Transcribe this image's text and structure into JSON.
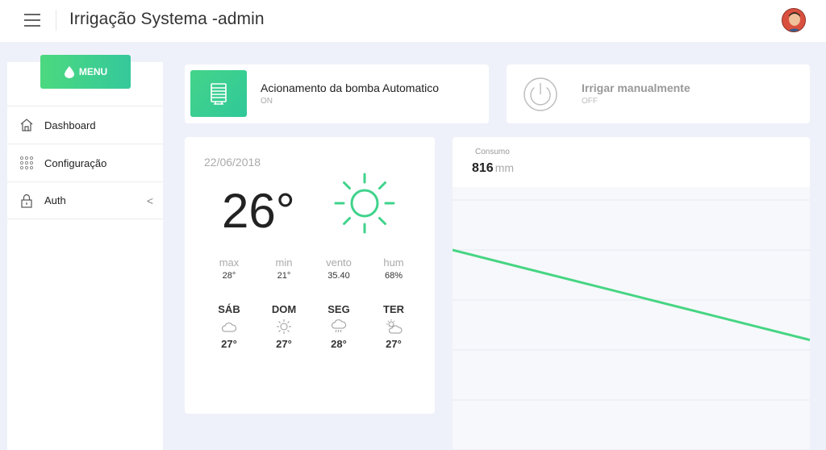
{
  "header": {
    "title": "Irrigação Systema -admin"
  },
  "sidebar": {
    "menu_label": "MENU",
    "items": [
      {
        "label": "Dashboard",
        "icon": "home-icon"
      },
      {
        "label": "Configuração",
        "icon": "grid-dots-icon"
      },
      {
        "label": "Auth",
        "icon": "lock-icon",
        "chevron": "<"
      }
    ]
  },
  "pump_card": {
    "title": "Acionamento da bomba Automatico",
    "status": "ON",
    "icon": "pump-icon"
  },
  "manual_card": {
    "title": "Irrigar manualmente",
    "status": "OFF",
    "icon": "power-icon"
  },
  "weather": {
    "date": "22/06/2018",
    "temperature": "26°",
    "stats": [
      {
        "label": "max",
        "value": "28°"
      },
      {
        "label": "min",
        "value": "21°"
      },
      {
        "label": "vento",
        "value": "35.40"
      },
      {
        "label": "hum",
        "value": "68%"
      }
    ],
    "forecast": [
      {
        "day": "SÁB",
        "icon": "cloud-icon",
        "temp": "27°"
      },
      {
        "day": "DOM",
        "icon": "sun-icon",
        "temp": "27°"
      },
      {
        "day": "SEG",
        "icon": "rain-cloud-icon",
        "temp": "28°"
      },
      {
        "day": "TER",
        "icon": "partly-cloudy-icon",
        "temp": "27°"
      }
    ]
  },
  "consumo": {
    "label": "Consumo",
    "value": "816",
    "unit": "mm"
  },
  "colors": {
    "accent": "#3fd38b",
    "line": "#46d583"
  },
  "chart_data": {
    "type": "line",
    "title": "",
    "xlabel": "",
    "ylabel": "",
    "x": [
      0,
      1
    ],
    "ylim": [
      0,
      5
    ],
    "series": [
      {
        "values": [
          4.0,
          2.2
        ]
      }
    ],
    "grid": true
  }
}
